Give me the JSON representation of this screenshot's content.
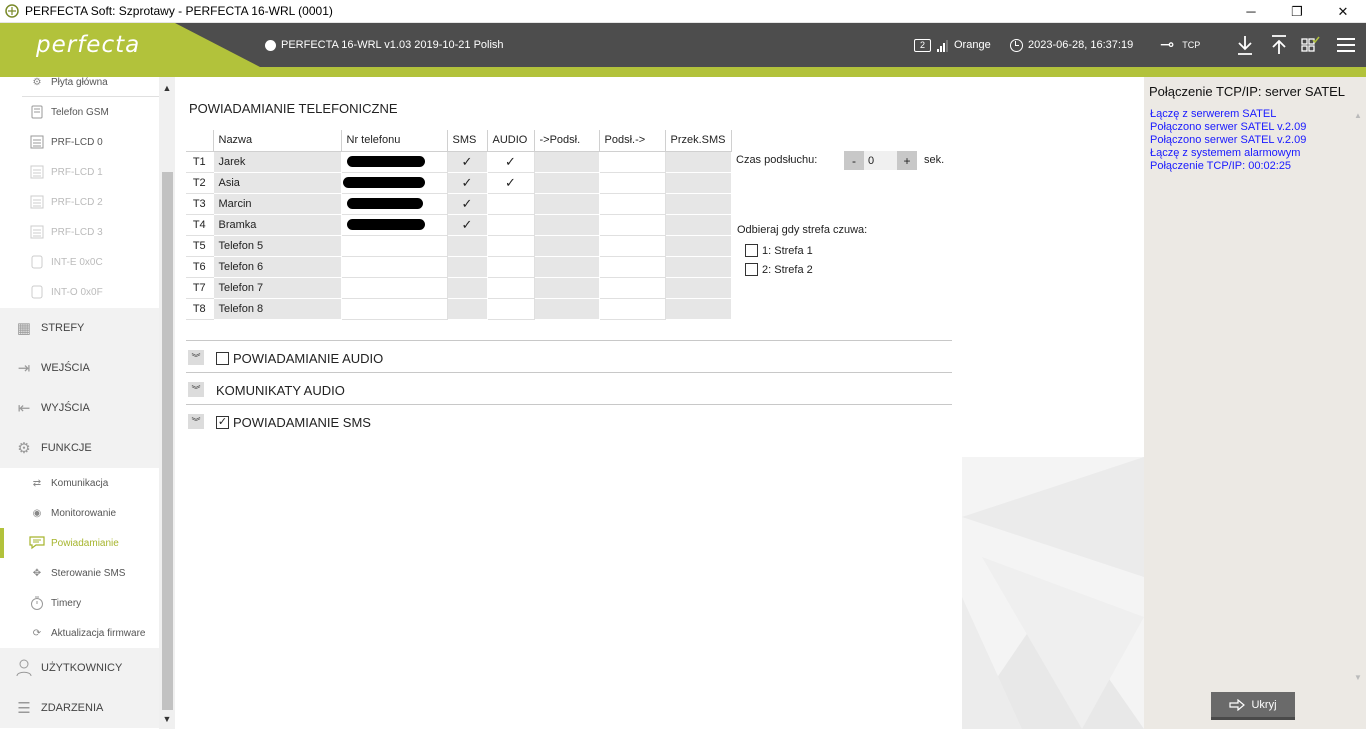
{
  "window": {
    "title": "PERFECTA Soft: Szprotawy - PERFECTA 16-WRL  (0001)",
    "minimize": "─",
    "restore": "❐",
    "close": "✕"
  },
  "header": {
    "logo": "perfecta",
    "device_info": "PERFECTA 16-WRL v1.03 2019-10-21 Polish",
    "sim_number": "2",
    "operator": "Orange",
    "datetime": "2023-06-28, 16:37:19",
    "connection": "TCP"
  },
  "sidebar": {
    "sub_top": [
      {
        "label": "Płyta główna",
        "icon": "board-icon",
        "dim": false
      },
      {
        "label": "Telefon GSM",
        "icon": "phone-icon",
        "dim": false
      },
      {
        "label": "PRF-LCD 0",
        "icon": "keypad-icon",
        "dim": false
      },
      {
        "label": "PRF-LCD 1",
        "icon": "keypad-icon",
        "dim": true
      },
      {
        "label": "PRF-LCD 2",
        "icon": "keypad-icon",
        "dim": true
      },
      {
        "label": "PRF-LCD 3",
        "icon": "keypad-icon",
        "dim": true
      },
      {
        "label": "INT-E 0x0C",
        "icon": "module-icon",
        "dim": true
      },
      {
        "label": "INT-O 0x0F",
        "icon": "module-icon",
        "dim": true
      }
    ],
    "sections": {
      "strefy": "STREFY",
      "wejscia": "WEJŚCIA",
      "wyjscia": "WYJŚCIA",
      "funkcje": "FUNKCJE",
      "uzytkownicy": "UŻYTKOWNICY",
      "zdarzenia": "ZDARZENIA"
    },
    "funkcje_items": [
      {
        "label": "Komunikacja",
        "icon": "communication-icon"
      },
      {
        "label": "Monitorowanie",
        "icon": "eye-icon"
      },
      {
        "label": "Powiadamianie",
        "icon": "notification-icon",
        "active": true
      },
      {
        "label": "Sterowanie SMS",
        "icon": "sms-control-icon"
      },
      {
        "label": "Timery",
        "icon": "timer-icon"
      },
      {
        "label": "Aktualizacja firmware",
        "icon": "update-icon"
      }
    ]
  },
  "main": {
    "title": "POWIADAMIANIE TELEFONICZNE",
    "table": {
      "headers": [
        "Nazwa",
        "Nr telefonu",
        "SMS",
        "AUDIO",
        "->Podsł.",
        "Podsł.->",
        "Przek.SMS"
      ],
      "rows": [
        {
          "id": "T1",
          "name": "Jarek",
          "phone_redacted": true,
          "sms": "✓",
          "audio": "✓"
        },
        {
          "id": "T2",
          "name": "Asia",
          "phone_redacted": true,
          "sms": "✓",
          "audio": "✓"
        },
        {
          "id": "T3",
          "name": "Marcin",
          "phone_redacted": true,
          "sms": "✓",
          "audio": ""
        },
        {
          "id": "T4",
          "name": "Bramka",
          "phone_redacted": true,
          "sms": "✓",
          "audio": ""
        },
        {
          "id": "T5",
          "name": "Telefon 5",
          "phone_redacted": false,
          "sms": "",
          "audio": ""
        },
        {
          "id": "T6",
          "name": "Telefon 6",
          "phone_redacted": false,
          "sms": "",
          "audio": ""
        },
        {
          "id": "T7",
          "name": "Telefon 7",
          "phone_redacted": false,
          "sms": "",
          "audio": ""
        },
        {
          "id": "T8",
          "name": "Telefon 8",
          "phone_redacted": false,
          "sms": "",
          "audio": ""
        }
      ]
    },
    "listen_time_label": "Czas podsłuchu:",
    "listen_time_value": "0",
    "listen_time_unit": "sek.",
    "minus": "-",
    "plus": "+",
    "answer_label": "Odbieraj gdy strefa czuwa:",
    "zones": [
      "1: Strefa 1",
      "2: Strefa 2"
    ],
    "collapsibles": [
      {
        "title": "POWIADAMIANIE AUDIO",
        "checkbox": true,
        "checked": false
      },
      {
        "title": "KOMUNIKATY AUDIO",
        "checkbox": false,
        "checked": false
      },
      {
        "title": "POWIADAMIANIE SMS",
        "checkbox": true,
        "checked": true
      }
    ]
  },
  "right_panel": {
    "title": "Połączenie TCP/IP: server SATEL",
    "log": [
      "Łączę z serwerem SATEL",
      "Połączono serwer SATEL v.2.09",
      "Połączono serwer SATEL v.2.09",
      "Łączę z systemem alarmowym",
      "Połączenie TCP/IP: 00:02:25"
    ],
    "hide_button": "Ukryj"
  },
  "colors": {
    "accent": "#b2c23b",
    "header_bg": "#4d4d4d",
    "log_text": "#1a1aff"
  }
}
